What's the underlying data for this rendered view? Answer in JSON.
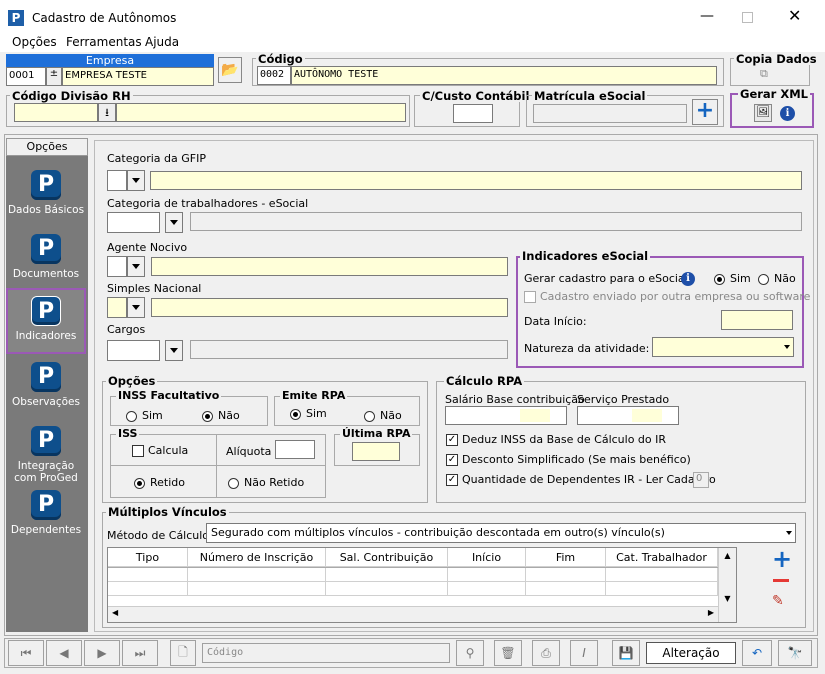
{
  "window": {
    "title": "Cadastro de Autônomos",
    "icon": "P"
  },
  "menu": [
    "Opções",
    "Ferramentas",
    "Ajuda"
  ],
  "empresa": {
    "label": "Empresa",
    "code": "0001",
    "name": "EMPRESA TESTE"
  },
  "codigo": {
    "label": "Código",
    "code": "0002",
    "name": "AUTÔNOMO TESTE"
  },
  "copia_dados": {
    "label": "Copia Dados"
  },
  "divisao": {
    "label": "Código Divisão RH"
  },
  "custo": {
    "label": "C/Custo Contábil"
  },
  "matricula": {
    "label": "Matrícula eSocial"
  },
  "gerar_xml": {
    "label": "Gerar XML"
  },
  "sidebar": {
    "header": "Opções",
    "items": [
      "Dados Básicos",
      "Documentos",
      "Indicadores",
      "Observações",
      "Integração com ProGed",
      "Dependentes"
    ]
  },
  "fields": {
    "gfip": "Categoria da GFIP",
    "cat_esocial": "Categoria de trabalhadores - eSocial",
    "agente": "Agente  Nocivo",
    "simples": "Simples Nacional",
    "cargos": "Cargos"
  },
  "indicadores": {
    "title": "Indicadores eSocial",
    "gerar_label": "Gerar cadastro para o eSocial:",
    "sim": "Sim",
    "nao": "Não",
    "enviado": "Cadastro enviado por outra empresa ou software",
    "data_inicio": "Data Início:",
    "natureza": "Natureza da atividade:"
  },
  "opcoes": {
    "title": "Opções",
    "inss_fac": "INSS Facultativo",
    "emite_rpa": "Emite RPA",
    "sim": "Sim",
    "nao": "Não",
    "iss": "ISS",
    "calcula": "Calcula",
    "aliquota": "Alíquota",
    "retido": "Retido",
    "nao_retido": "Não Retido",
    "ultima_rpa": "Última RPA"
  },
  "calculo": {
    "title": "Cálculo RPA",
    "salario": "Salário Base contribuição",
    "servico": "Serviço Prestado",
    "deduz": "Deduz INSS da Base de Cálculo do IR",
    "desconto": "Desconto Simplificado (Se mais benéfico)",
    "dependentes": "Quantidade de Dependentes IR - Ler Cadastro",
    "dep_value": "0"
  },
  "multiplos": {
    "title": "Múltiplos Vínculos",
    "metodo_label": "Método de Cálculo",
    "metodo_value": "Segurado com múltiplos vínculos - contribuição descontada em outro(s) vínculo(s)",
    "columns": [
      "Tipo",
      "Número de Inscrição",
      "Sal. Contribuição",
      "Início",
      "Fim",
      "Cat. Trabalhador"
    ]
  },
  "bottom": {
    "codigo_placeholder": "Código",
    "status": "Alteração"
  },
  "colors": {
    "accent_border": "#9b59b6",
    "field_yellow": "#ffffd9",
    "sidebar_bg": "#7a7a7a",
    "title_blue": "#1e6fd9"
  }
}
